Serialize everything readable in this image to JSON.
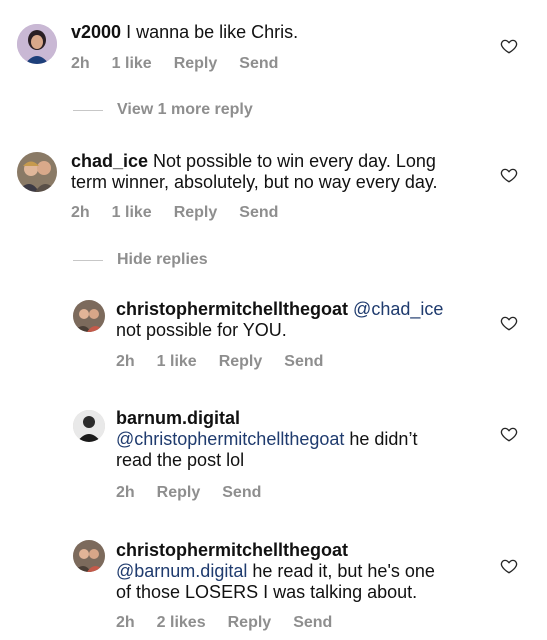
{
  "comments": [
    {
      "username": "v2000",
      "text": " I wanna be like Chris.",
      "time": "2h",
      "likes": "1 like",
      "reply": "Reply",
      "send": "Send"
    },
    {
      "username": "chad_ice",
      "text_line1": " Not possible to win every day. Long",
      "text_line2": "term winner, absolutely, but no way every day.",
      "time": "2h",
      "likes": "1 like",
      "reply": "Reply",
      "send": "Send"
    }
  ],
  "replies": [
    {
      "username": "christophermitchellthegoat",
      "mention": "@chad_ice",
      "text": "not possible for YOU.",
      "time": "2h",
      "likes": "1 like",
      "reply": "Reply",
      "send": "Send"
    },
    {
      "username": "barnum.digital",
      "mention": "@christophermitchellthegoat",
      "text_after_mention": " he didn’t",
      "text_line2": "read the post lol",
      "time": "2h",
      "reply": "Reply",
      "send": "Send"
    },
    {
      "username": "christophermitchellthegoat",
      "mention": "@barnum.digital",
      "text_after_mention": " he read it, but he's one",
      "text_line2": "of those LOSERS I was talking about.",
      "time": "2h",
      "likes": "2 likes",
      "reply": "Reply",
      "send": "Send"
    }
  ],
  "view_more_replies": "View 1 more reply",
  "hide_replies": "Hide replies"
}
